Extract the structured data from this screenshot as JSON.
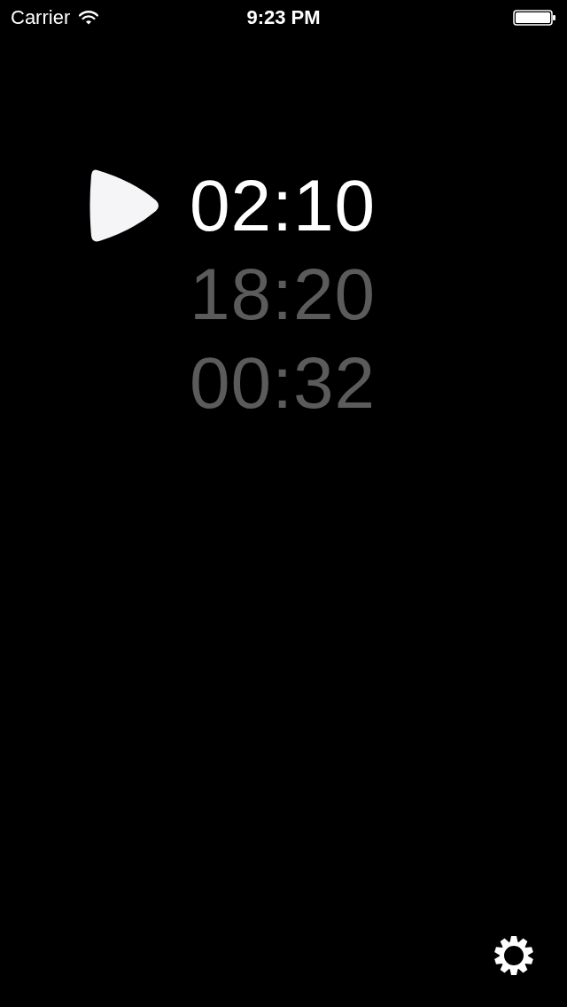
{
  "status_bar": {
    "carrier": "Carrier",
    "time": "9:23 PM"
  },
  "timers": [
    {
      "time": "02:10",
      "selected": true
    },
    {
      "time": "18:20",
      "selected": false
    },
    {
      "time": "00:32",
      "selected": false
    }
  ]
}
